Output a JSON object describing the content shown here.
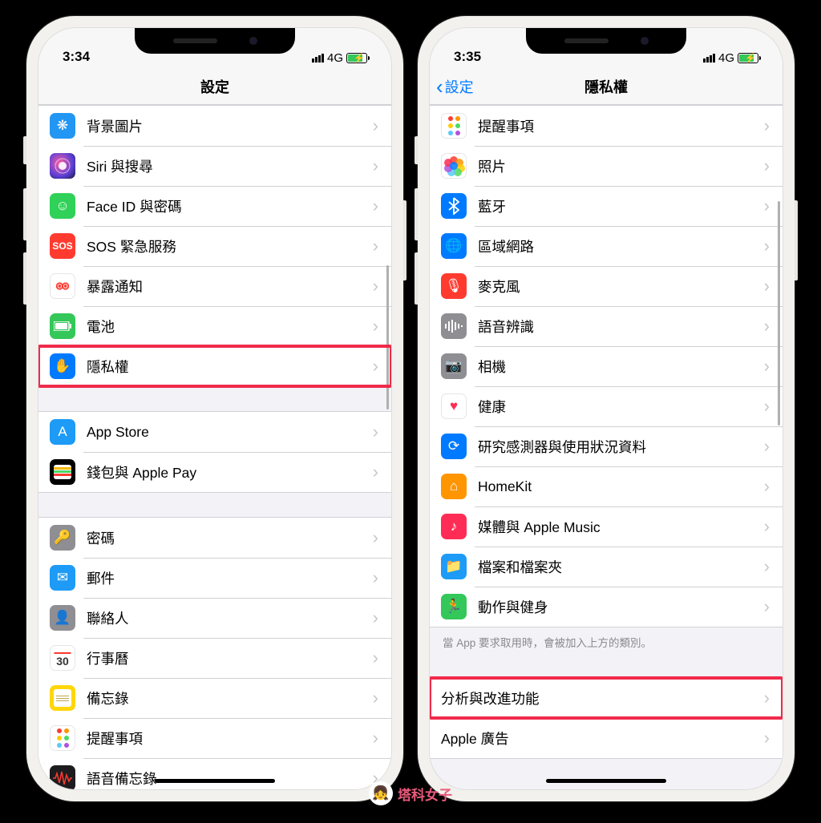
{
  "watermark": "塔科女子",
  "left": {
    "status": {
      "time": "3:34",
      "network": "4G"
    },
    "nav": {
      "title": "設定"
    },
    "groups": [
      {
        "rows": [
          {
            "key": "wallpaper",
            "label": "背景圖片",
            "iconClass": "ic-wallpaper",
            "glyph": "❋"
          },
          {
            "key": "siri",
            "label": "Siri 與搜尋",
            "iconClass": "ic-siri",
            "glyph": ""
          },
          {
            "key": "faceid",
            "label": "Face ID 與密碼",
            "iconClass": "ic-faceid",
            "glyph": "☺"
          },
          {
            "key": "sos",
            "label": "SOS 緊急服務",
            "iconClass": "ic-sos",
            "glyph": "SOS"
          },
          {
            "key": "exposure",
            "label": "暴露通知",
            "iconClass": "ic-exposure",
            "glyph": ""
          },
          {
            "key": "battery",
            "label": "電池",
            "iconClass": "ic-battery",
            "glyph": ""
          },
          {
            "key": "privacy",
            "label": "隱私權",
            "iconClass": "ic-privacy",
            "glyph": "✋",
            "highlight": true
          }
        ]
      },
      {
        "rows": [
          {
            "key": "appstore",
            "label": "App Store",
            "iconClass": "ic-appstore",
            "glyph": "A"
          },
          {
            "key": "wallet",
            "label": "錢包與 Apple Pay",
            "iconClass": "ic-wallet",
            "glyph": ""
          }
        ]
      },
      {
        "rows": [
          {
            "key": "passwords",
            "label": "密碼",
            "iconClass": "ic-passwords",
            "glyph": "🔑"
          },
          {
            "key": "mail",
            "label": "郵件",
            "iconClass": "ic-mail",
            "glyph": "✉"
          },
          {
            "key": "contacts",
            "label": "聯絡人",
            "iconClass": "ic-contacts",
            "glyph": "👤"
          },
          {
            "key": "calendar",
            "label": "行事曆",
            "iconClass": "ic-calendar",
            "glyph": ""
          },
          {
            "key": "notes",
            "label": "備忘錄",
            "iconClass": "ic-notes",
            "glyph": ""
          },
          {
            "key": "reminders",
            "label": "提醒事項",
            "iconClass": "ic-reminders",
            "glyph": ""
          },
          {
            "key": "voicememos",
            "label": "語音備忘錄",
            "iconClass": "ic-voicememos",
            "glyph": ""
          }
        ]
      }
    ]
  },
  "right": {
    "status": {
      "time": "3:35",
      "network": "4G"
    },
    "nav": {
      "back": "設定",
      "title": "隱私權"
    },
    "groups": [
      {
        "rows": [
          {
            "key": "reminders2",
            "label": "提醒事項",
            "iconClass": "ic-reminders",
            "glyph": ""
          },
          {
            "key": "photos",
            "label": "照片",
            "iconClass": "ic-photos",
            "glyph": ""
          },
          {
            "key": "bluetooth",
            "label": "藍牙",
            "iconClass": "ic-bluetooth",
            "glyph": ""
          },
          {
            "key": "localnet",
            "label": "區域網路",
            "iconClass": "ic-network",
            "glyph": "🌐"
          },
          {
            "key": "microphone",
            "label": "麥克風",
            "iconClass": "ic-mic",
            "glyph": "🎙"
          },
          {
            "key": "speech",
            "label": "語音辨識",
            "iconClass": "ic-speech",
            "glyph": ""
          },
          {
            "key": "camera",
            "label": "相機",
            "iconClass": "ic-camera",
            "glyph": "📷"
          },
          {
            "key": "health",
            "label": "健康",
            "iconClass": "ic-health",
            "glyph": "♥"
          },
          {
            "key": "research",
            "label": "研究感測器與使用狀況資料",
            "iconClass": "ic-research",
            "glyph": "⟳"
          },
          {
            "key": "homekit",
            "label": "HomeKit",
            "iconClass": "ic-homekit",
            "glyph": "⌂"
          },
          {
            "key": "media",
            "label": "媒體與 Apple Music",
            "iconClass": "ic-media",
            "glyph": "♪"
          },
          {
            "key": "files",
            "label": "檔案和檔案夾",
            "iconClass": "ic-files",
            "glyph": "📁"
          },
          {
            "key": "motion",
            "label": "動作與健身",
            "iconClass": "ic-motion",
            "glyph": "🏃"
          }
        ],
        "footer": "當 App 要求取用時，會被加入上方的類別。"
      },
      {
        "rows": [
          {
            "key": "analytics",
            "label": "分析與改進功能",
            "noIcon": true,
            "highlight": true
          },
          {
            "key": "appleads",
            "label": "Apple 廣告",
            "noIcon": true
          }
        ]
      }
    ]
  }
}
